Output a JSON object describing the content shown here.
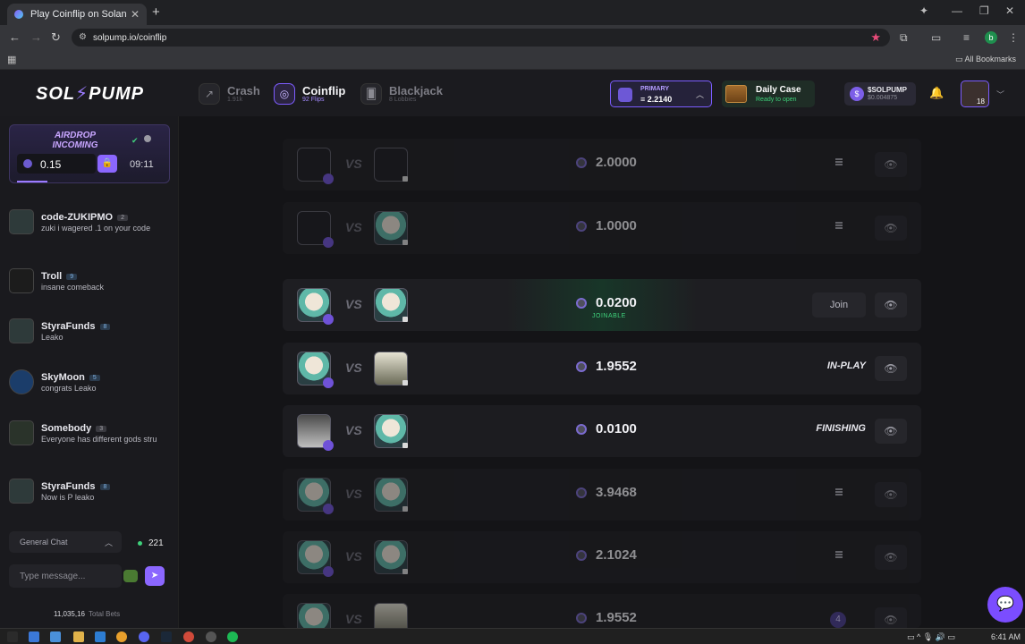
{
  "browser": {
    "tab_title": "Play Coinflip on Solana – No K",
    "url": "solpump.io/coinflip",
    "all_bookmarks": "All Bookmarks",
    "profile_initial": "b"
  },
  "header": {
    "logo": "SOL PUMP",
    "games": [
      {
        "name": "Crash",
        "sub": "1.91k"
      },
      {
        "name": "Coinflip",
        "sub": "92 Flips"
      },
      {
        "name": "Blackjack",
        "sub": "8 Lobbies"
      }
    ],
    "wallet": {
      "label": "PRIMARY",
      "balance": "2.2140"
    },
    "daily_case": {
      "title": "Daily Case",
      "status": "Ready to open"
    },
    "token": {
      "name": "$SOLPUMP",
      "price": "$0.004875"
    },
    "user_level": "18"
  },
  "sidebar": {
    "airdrop": {
      "title": "AIRDROP INCOMING",
      "amount": "0.15",
      "timer": "09:11"
    },
    "messages": [
      {
        "user": "code-ZUKIPMO",
        "level": "2",
        "text": "zuki i wagered .1 on your code"
      },
      {
        "user": "Troll",
        "level": "9",
        "text": "insane comeback"
      },
      {
        "user": "StyraFunds",
        "level": "8",
        "text": "Leako"
      },
      {
        "user": "SkyMoon",
        "level": "5",
        "text": "congrats Leako"
      },
      {
        "user": "Somebody",
        "level": "3",
        "text": "Everyone has different gods stru"
      },
      {
        "user": "StyraFunds",
        "level": "8",
        "text": "Now is P leako"
      }
    ],
    "channel": "General Chat",
    "online_count": "221",
    "input_placeholder": "Type message...",
    "total_bets_value": "11,035,16",
    "total_bets_label": "Total Bets"
  },
  "flips": [
    {
      "amount": "2.0000",
      "status": ""
    },
    {
      "amount": "1.0000",
      "status": ""
    },
    {
      "amount": "0.0200",
      "status": "JOINABLE",
      "action": "Join"
    },
    {
      "amount": "1.9552",
      "status": "IN-PLAY"
    },
    {
      "amount": "0.0100",
      "status": "FINISHING"
    },
    {
      "amount": "3.9468",
      "status": ""
    },
    {
      "amount": "2.1024",
      "status": ""
    },
    {
      "amount": "1.9552",
      "status": "",
      "count": "4"
    }
  ],
  "taskbar": {
    "time": "6:41 AM"
  },
  "colors": {
    "accent": "#8b67ff",
    "joinable": "#3fd17b",
    "background": "#141417"
  }
}
